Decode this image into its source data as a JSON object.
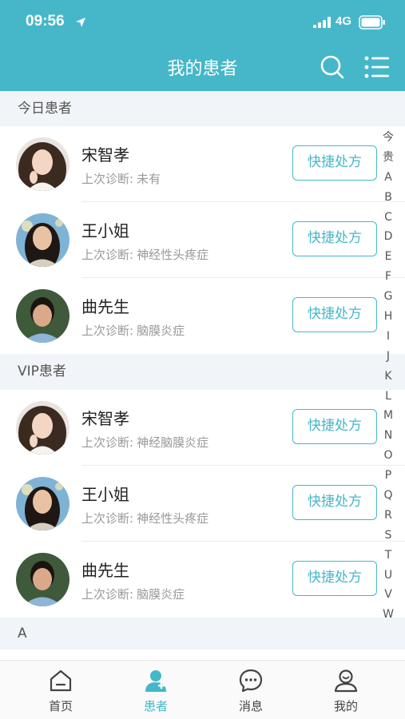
{
  "status_bar": {
    "time": "09:56",
    "network": "4G"
  },
  "nav": {
    "title": "我的患者"
  },
  "sections": [
    {
      "title": "今日患者",
      "patients": [
        {
          "name": "宋智孝",
          "diag_label": "上次诊断:",
          "diag_value": "未有",
          "action": "快捷处方"
        },
        {
          "name": "王小姐",
          "diag_label": "上次诊断:",
          "diag_value": "神经性头疼症",
          "action": "快捷处方"
        },
        {
          "name": "曲先生",
          "diag_label": "上次诊断:",
          "diag_value": "脑膜炎症",
          "action": "快捷处方"
        }
      ]
    },
    {
      "title": "VIP患者",
      "patients": [
        {
          "name": "宋智孝",
          "diag_label": "上次诊断:",
          "diag_value": "神经脑膜炎症",
          "action": "快捷处方"
        },
        {
          "name": "王小姐",
          "diag_label": "上次诊断:",
          "diag_value": "神经性头疼症",
          "action": "快捷处方"
        },
        {
          "name": "曲先生",
          "diag_label": "上次诊断:",
          "diag_value": "脑膜炎症",
          "action": "快捷处方"
        }
      ]
    },
    {
      "title": "A",
      "patients": []
    }
  ],
  "index_bar": [
    "今",
    "贵",
    "A",
    "B",
    "C",
    "D",
    "E",
    "F",
    "G",
    "H",
    "I",
    "J",
    "K",
    "L",
    "M",
    "N",
    "O",
    "P",
    "Q",
    "R",
    "S",
    "T",
    "U",
    "V",
    "W"
  ],
  "tabbar": [
    {
      "label": "首页",
      "icon": "home-icon",
      "active": false
    },
    {
      "label": "患者",
      "icon": "patient-icon",
      "active": true
    },
    {
      "label": "消息",
      "icon": "message-icon",
      "active": false
    },
    {
      "label": "我的",
      "icon": "profile-icon",
      "active": false
    }
  ],
  "colors": {
    "accent": "#45b7c9",
    "section_bg": "#f1f4f8"
  }
}
